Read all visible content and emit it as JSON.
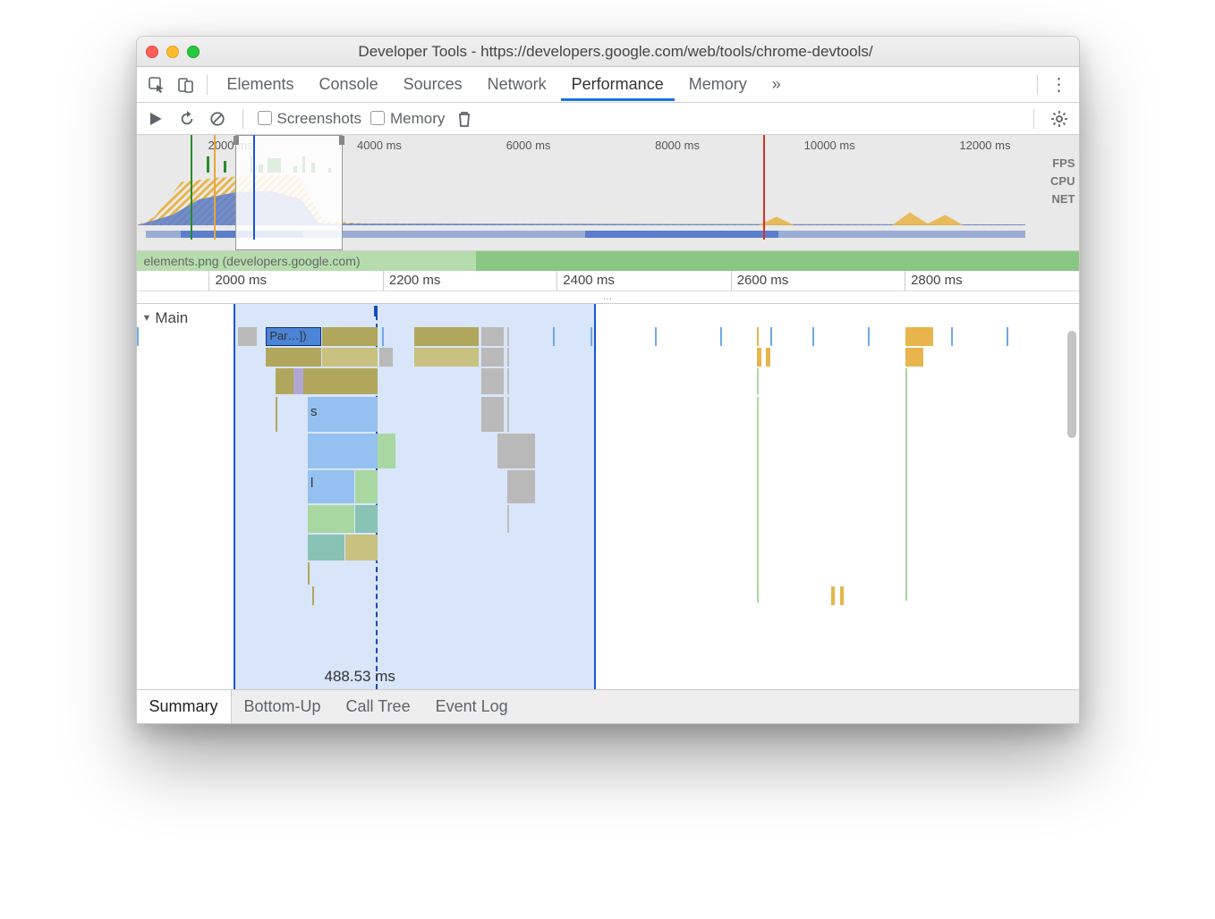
{
  "window": {
    "title": "Developer Tools - https://developers.google.com/web/tools/chrome-devtools/"
  },
  "tabs": {
    "items": [
      "Elements",
      "Console",
      "Sources",
      "Network",
      "Performance",
      "Memory"
    ],
    "active": "Performance",
    "overflow": "»"
  },
  "toolbar": {
    "screenshots_label": "Screenshots",
    "memory_label": "Memory"
  },
  "overview": {
    "ticks": [
      "2000 ms",
      "4000 ms",
      "6000 ms",
      "8000 ms",
      "10000 ms",
      "12000 ms"
    ],
    "tracks": [
      "FPS",
      "CPU",
      "NET"
    ],
    "selection_start_ms": 1900,
    "selection_end_ms": 3000,
    "load_event_ms": 8500
  },
  "ruler": {
    "resource_label": "elements.png (developers.google.com)",
    "ticks": [
      "2000 ms",
      "2200 ms",
      "2400 ms",
      "2600 ms",
      "2800 ms"
    ],
    "ellipsis": "…"
  },
  "flame": {
    "section_label": "Main",
    "selected_task_label": "Par…])",
    "frame_label_s": "s",
    "frame_label_l": "l",
    "selection_duration": "488.53 ms"
  },
  "bottom_tabs": {
    "items": [
      "Summary",
      "Bottom-Up",
      "Call Tree",
      "Event Log"
    ],
    "active": "Summary"
  }
}
